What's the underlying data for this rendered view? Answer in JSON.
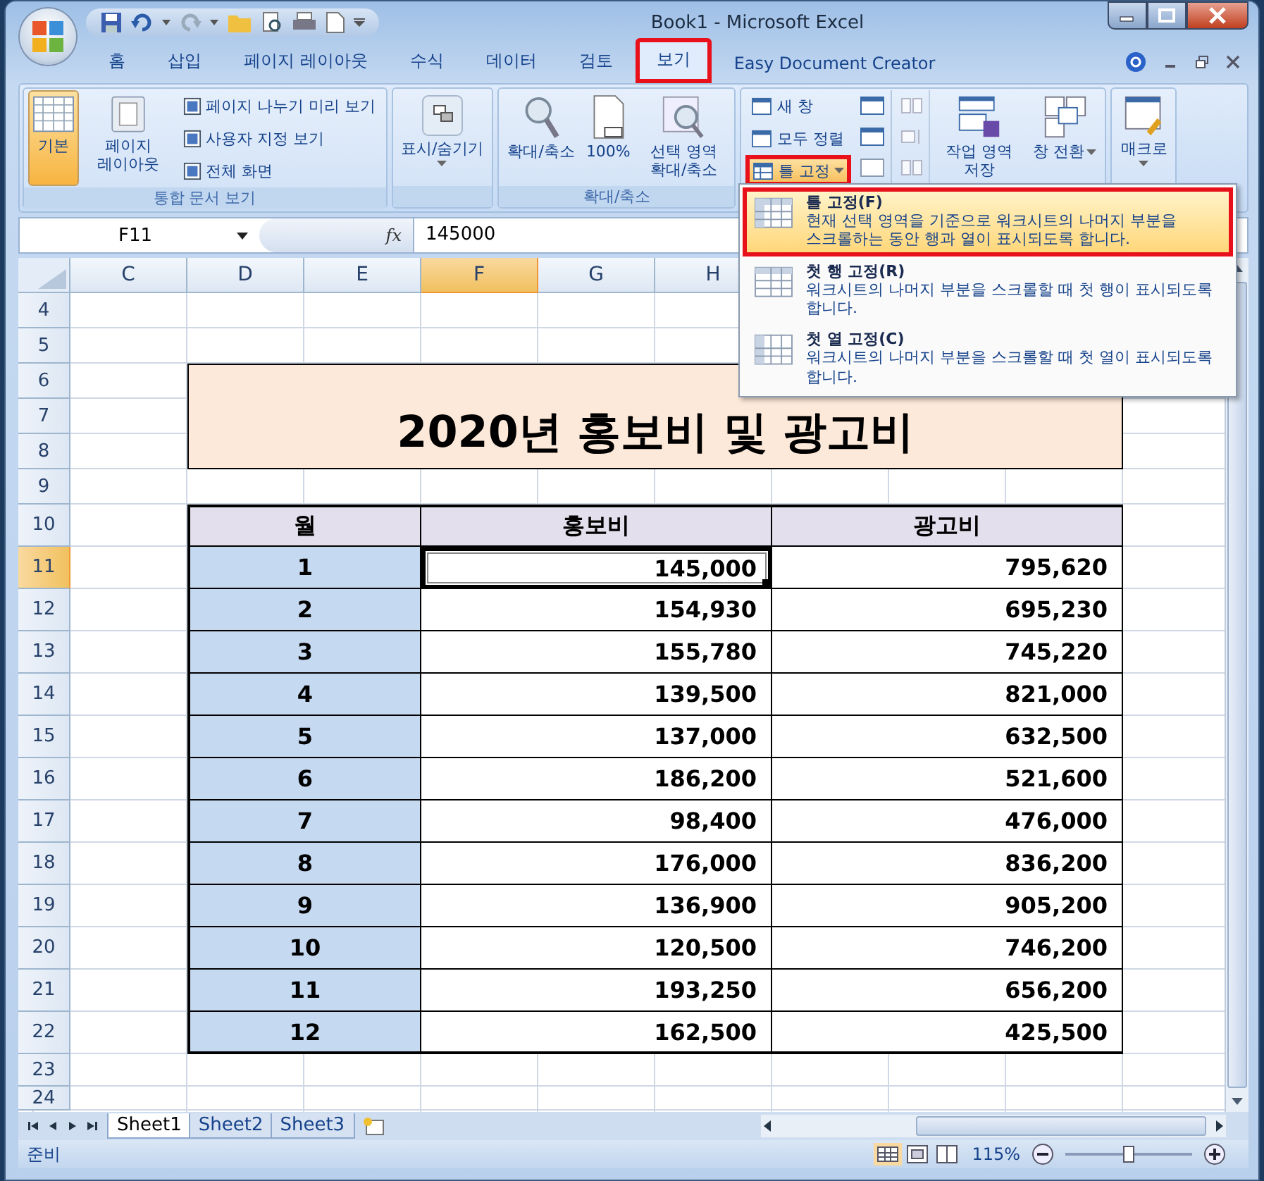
{
  "window": {
    "title": "Book1 - Microsoft Excel"
  },
  "ribbon_tabs": [
    {
      "label": "홈",
      "selected": false,
      "marked": false
    },
    {
      "label": "삽입",
      "selected": false,
      "marked": false
    },
    {
      "label": "페이지 레이아웃",
      "selected": false,
      "marked": false
    },
    {
      "label": "수식",
      "selected": false,
      "marked": false
    },
    {
      "label": "데이터",
      "selected": false,
      "marked": false
    },
    {
      "label": "검토",
      "selected": false,
      "marked": false
    },
    {
      "label": "보기",
      "selected": true,
      "marked": true
    },
    {
      "label": "Easy Document Creator",
      "selected": false,
      "marked": false
    }
  ],
  "ribbon": {
    "workbook_views": {
      "label": "통합 문서 보기",
      "large": [
        {
          "label": "기본",
          "selected": true
        },
        {
          "label": "페이지 레이아웃",
          "selected": false
        }
      ],
      "small": [
        "페이지 나누기 미리 보기",
        "사용자 지정 보기",
        "전체 화면"
      ]
    },
    "show_hide": {
      "label": "표시/숨기기"
    },
    "zoom": {
      "label": "확대/축소",
      "buttons": [
        "확대/축소",
        "100%",
        "선택 영역 확대/축소"
      ]
    },
    "window_group": {
      "small": [
        {
          "label": "새 창",
          "marked": false,
          "dropdown": false
        },
        {
          "label": "모두 정렬",
          "marked": false,
          "dropdown": false
        },
        {
          "label": "틀 고정",
          "marked": true,
          "dropdown": true
        }
      ],
      "large": [
        {
          "label": "작업 영역 저장",
          "dropdown": false
        },
        {
          "label": "창 전환",
          "dropdown": true
        }
      ]
    },
    "macros": {
      "label": "매크로"
    }
  },
  "formula_bar": {
    "name_box": "F11",
    "function_label": "fx",
    "value": "145000"
  },
  "sheet": {
    "columns": [
      {
        "label": "C",
        "selected": false
      },
      {
        "label": "D",
        "selected": false
      },
      {
        "label": "E",
        "selected": false
      },
      {
        "label": "F",
        "selected": true
      },
      {
        "label": "G",
        "selected": false
      },
      {
        "label": "H",
        "selected": false
      }
    ],
    "row_headers": [
      {
        "label": "4",
        "selected": false
      },
      {
        "label": "5",
        "selected": false
      },
      {
        "label": "6",
        "selected": false
      },
      {
        "label": "7",
        "selected": false
      },
      {
        "label": "8",
        "selected": false
      },
      {
        "label": "9",
        "selected": false
      },
      {
        "label": "10",
        "selected": false
      },
      {
        "label": "11",
        "selected": true
      },
      {
        "label": "12",
        "selected": false
      },
      {
        "label": "13",
        "selected": false
      },
      {
        "label": "14",
        "selected": false
      },
      {
        "label": "15",
        "selected": false
      },
      {
        "label": "16",
        "selected": false
      },
      {
        "label": "17",
        "selected": false
      },
      {
        "label": "18",
        "selected": false
      },
      {
        "label": "19",
        "selected": false
      },
      {
        "label": "20",
        "selected": false
      },
      {
        "label": "21",
        "selected": false
      },
      {
        "label": "22",
        "selected": false
      },
      {
        "label": "23",
        "selected": false
      },
      {
        "label": "24",
        "selected": false
      }
    ],
    "title": "2020년 홍보비 및 광고비",
    "table": {
      "header": [
        "월",
        "홍보비",
        "광고비"
      ],
      "rows": [
        {
          "cells": [
            {
              "text": "1",
              "selected": false
            },
            {
              "text": "145,000",
              "selected": true
            },
            {
              "text": "795,620",
              "selected": false
            }
          ]
        },
        {
          "cells": [
            {
              "text": "2",
              "selected": false
            },
            {
              "text": "154,930",
              "selected": false
            },
            {
              "text": "695,230",
              "selected": false
            }
          ]
        },
        {
          "cells": [
            {
              "text": "3",
              "selected": false
            },
            {
              "text": "155,780",
              "selected": false
            },
            {
              "text": "745,220",
              "selected": false
            }
          ]
        },
        {
          "cells": [
            {
              "text": "4",
              "selected": false
            },
            {
              "text": "139,500",
              "selected": false
            },
            {
              "text": "821,000",
              "selected": false
            }
          ]
        },
        {
          "cells": [
            {
              "text": "5",
              "selected": false
            },
            {
              "text": "137,000",
              "selected": false
            },
            {
              "text": "632,500",
              "selected": false
            }
          ]
        },
        {
          "cells": [
            {
              "text": "6",
              "selected": false
            },
            {
              "text": "186,200",
              "selected": false
            },
            {
              "text": "521,600",
              "selected": false
            }
          ]
        },
        {
          "cells": [
            {
              "text": "7",
              "selected": false
            },
            {
              "text": "98,400",
              "selected": false
            },
            {
              "text": "476,000",
              "selected": false
            }
          ]
        },
        {
          "cells": [
            {
              "text": "8",
              "selected": false
            },
            {
              "text": "176,000",
              "selected": false
            },
            {
              "text": "836,200",
              "selected": false
            }
          ]
        },
        {
          "cells": [
            {
              "text": "9",
              "selected": false
            },
            {
              "text": "136,900",
              "selected": false
            },
            {
              "text": "905,200",
              "selected": false
            }
          ]
        },
        {
          "cells": [
            {
              "text": "10",
              "selected": false
            },
            {
              "text": "120,500",
              "selected": false
            },
            {
              "text": "746,200",
              "selected": false
            }
          ]
        },
        {
          "cells": [
            {
              "text": "11",
              "selected": false
            },
            {
              "text": "193,250",
              "selected": false
            },
            {
              "text": "656,200",
              "selected": false
            }
          ]
        },
        {
          "cells": [
            {
              "text": "12",
              "selected": false
            },
            {
              "text": "162,500",
              "selected": false
            },
            {
              "text": "425,500",
              "selected": false
            }
          ]
        }
      ]
    }
  },
  "freeze_menu": [
    {
      "title": "틀 고정(F)",
      "description": "현재 선택 영역을 기준으로 워크시트의 나머지 부분을 스크롤하는 동안 행과 열이 표시되도록 합니다.",
      "hovered": true,
      "marked": true
    },
    {
      "title": "첫 행 고정(R)",
      "description": "워크시트의 나머지 부분을 스크롤할 때 첫 행이 표시되도록 합니다.",
      "hovered": false,
      "marked": false
    },
    {
      "title": "첫 열 고정(C)",
      "description": "워크시트의 나머지 부분을 스크롤할 때 첫 열이 표시되도록 합니다.",
      "hovered": false,
      "marked": false
    }
  ],
  "sheet_tabs": [
    {
      "label": "Sheet1",
      "selected": true
    },
    {
      "label": "Sheet2",
      "selected": false
    },
    {
      "label": "Sheet3",
      "selected": false
    }
  ],
  "status_bar": {
    "status": "준비",
    "zoom": "115%",
    "zoom_slider": {
      "level": 0.5
    }
  }
}
